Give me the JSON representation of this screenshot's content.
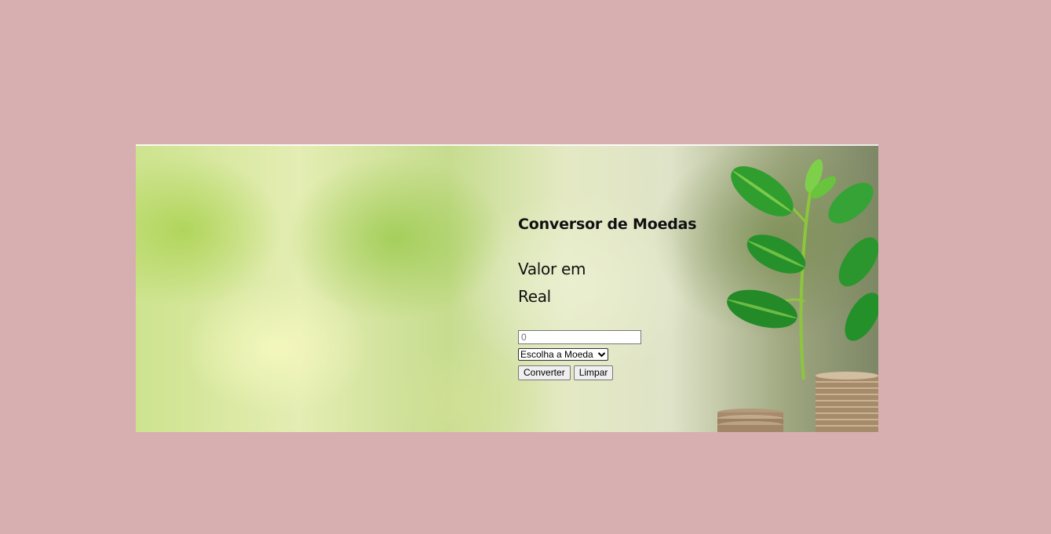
{
  "page": {
    "background_color": "#d8afb0"
  },
  "converter": {
    "title": "Conversor de Moedas",
    "label": "Valor em Real",
    "input": {
      "placeholder": "0",
      "value": ""
    },
    "select": {
      "selected": "Escolha a Moeda"
    },
    "buttons": {
      "convert": "Converter",
      "clear": "Limpar"
    }
  },
  "banner": {
    "image": "plant-and-coins-photo"
  }
}
